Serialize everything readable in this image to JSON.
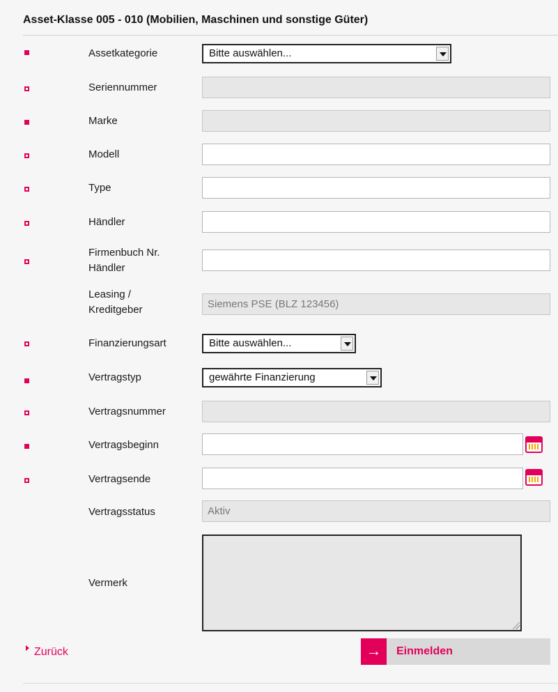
{
  "section_title": "Asset-Klasse 005 - 010 (Mobilien, Maschinen und sonstige Güter)",
  "colors": {
    "accent": "#e2005a",
    "readonly_bg": "#e7e7e7",
    "button_bg": "#d9d9d9"
  },
  "fields": {
    "assetkategorie": {
      "label": "Assetkategorie",
      "value": "Bitte auswählen..."
    },
    "seriennummer": {
      "label": "Seriennummer",
      "value": ""
    },
    "marke": {
      "label": "Marke",
      "value": ""
    },
    "modell": {
      "label": "Modell",
      "value": ""
    },
    "type": {
      "label": "Type",
      "value": ""
    },
    "haendler": {
      "label": "Händler",
      "value": ""
    },
    "firmenbuch": {
      "label_line1": "Firmenbuch Nr.",
      "label_line2": "Händler",
      "value": ""
    },
    "kreditgeber": {
      "label_line1": "Leasing /",
      "label_line2": "Kreditgeber",
      "value": "Siemens PSE (BLZ 123456)"
    },
    "finanzierungsart": {
      "label": "Finanzierungsart",
      "value": "Bitte auswählen..."
    },
    "vertragstyp": {
      "label": "Vertragstyp",
      "value": "gewährte Finanzierung"
    },
    "vertragsnummer": {
      "label": "Vertragsnummer",
      "value": ""
    },
    "vertragsbeginn": {
      "label": "Vertragsbeginn",
      "value": ""
    },
    "vertragsende": {
      "label": "Vertragsende",
      "value": ""
    },
    "vertragsstatus": {
      "label": "Vertragsstatus",
      "value": "Aktiv"
    },
    "vermerk": {
      "label": "Vermerk",
      "value": ""
    }
  },
  "icons": {
    "calendar": "calendar-icon",
    "submit_arrow": "→"
  },
  "actions": {
    "back_label": "Zurück",
    "submit_label": "Einmelden"
  }
}
